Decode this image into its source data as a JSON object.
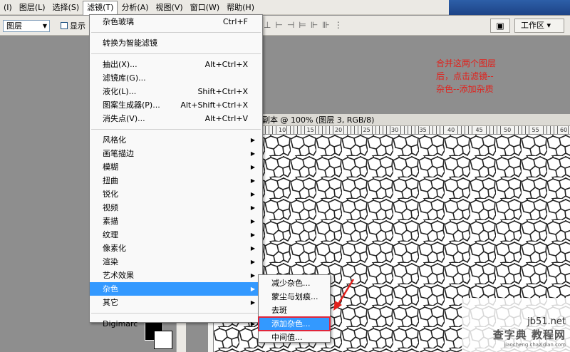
{
  "menubar": {
    "items": [
      {
        "label": "(I)"
      },
      {
        "label": "图层(L)"
      },
      {
        "label": "选择(S)"
      },
      {
        "label": "滤镜(T)",
        "active": true
      },
      {
        "label": "分析(A)"
      },
      {
        "label": "视图(V)"
      },
      {
        "label": "窗口(W)"
      },
      {
        "label": "帮助(H)"
      }
    ]
  },
  "optbar": {
    "layer_select": "图层",
    "checkbox_label": "显示",
    "align_icons": [
      "⊥",
      "⊢",
      "⊣",
      "⊨",
      "⊩",
      "⊪",
      "⋮"
    ],
    "workspace_label": "工作区 ▾",
    "workspace_icon": "▣"
  },
  "filter_menu": {
    "groups": [
      [
        {
          "label": "杂色玻璃",
          "shortcut": "Ctrl+F"
        }
      ],
      [
        {
          "label": "转换为智能滤镜"
        }
      ],
      [
        {
          "label": "抽出(X)...",
          "shortcut": "Alt+Ctrl+X"
        },
        {
          "label": "滤镜库(G)..."
        },
        {
          "label": "液化(L)...",
          "shortcut": "Shift+Ctrl+X"
        },
        {
          "label": "图案生成器(P)...",
          "shortcut": "Alt+Shift+Ctrl+X"
        },
        {
          "label": "消失点(V)...",
          "shortcut": "Alt+Ctrl+V"
        }
      ],
      [
        {
          "label": "风格化",
          "sub": true
        },
        {
          "label": "画笔描边",
          "sub": true
        },
        {
          "label": "模糊",
          "sub": true
        },
        {
          "label": "扭曲",
          "sub": true
        },
        {
          "label": "锐化",
          "sub": true
        },
        {
          "label": "视频",
          "sub": true
        },
        {
          "label": "素描",
          "sub": true
        },
        {
          "label": "纹理",
          "sub": true
        },
        {
          "label": "像素化",
          "sub": true
        },
        {
          "label": "渲染",
          "sub": true
        },
        {
          "label": "艺术效果",
          "sub": true
        },
        {
          "label": "杂色",
          "sub": true,
          "highlight": true
        },
        {
          "label": "其它",
          "sub": true
        }
      ],
      [
        {
          "label": "Digimarc",
          "sub": true
        }
      ]
    ]
  },
  "noise_submenu": {
    "items": [
      {
        "label": "减少杂色..."
      },
      {
        "label": "蒙尘与划痕..."
      },
      {
        "label": "去斑"
      },
      {
        "label": "添加杂色...",
        "highlight": true
      },
      {
        "label": "中间值..."
      }
    ]
  },
  "document": {
    "title": "副本 @ 100% (图层 3, RGB/8)",
    "ruler_labels": [
      "10",
      "15",
      "20",
      "25",
      "30",
      "35",
      "40",
      "45",
      "50",
      "55",
      "60"
    ]
  },
  "annotation": {
    "lines": [
      "合并这两个图层",
      "后，点击滤镜--",
      "杂色--添加杂质"
    ],
    "color": "#e2211c"
  },
  "watermark": {
    "site": "jb51.net",
    "brand": "查字典 教程网",
    "url": "jiaocheng.chazidian.com"
  },
  "colors": {
    "menu_highlight": "#3399ff",
    "outline_red": "#e0253a"
  }
}
